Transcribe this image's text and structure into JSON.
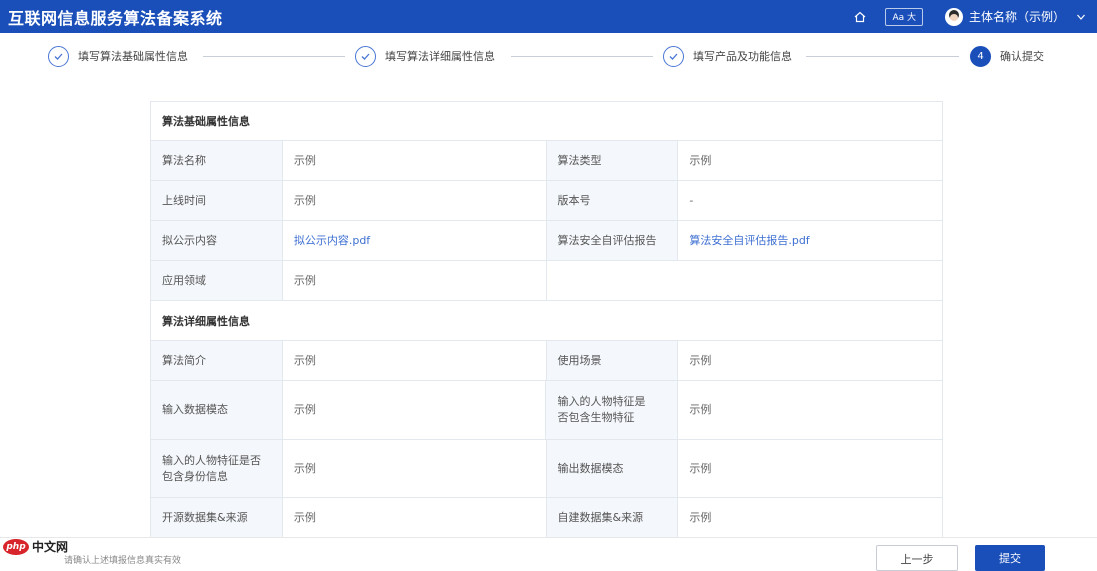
{
  "header": {
    "title": "互联网信息服务算法备案系统",
    "font_size_toggle": "Aa 大",
    "user_name": "主体名称（示例）",
    "icons": [
      "home-icon",
      "avatar",
      "chevron-down-icon"
    ]
  },
  "steps": [
    {
      "label": "填写算法基础属性信息",
      "status": "done"
    },
    {
      "label": "填写算法详细属性信息",
      "status": "done"
    },
    {
      "label": "填写产品及功能信息",
      "status": "done"
    },
    {
      "label": "确认提交",
      "number": "4",
      "status": "active"
    }
  ],
  "basic_section": {
    "title": "算法基础属性信息",
    "rows": [
      {
        "k1": "算法名称",
        "v1": "示例",
        "k2": "算法类型",
        "v2": "示例"
      },
      {
        "k1": "上线时间",
        "v1": "示例",
        "k2": "版本号",
        "v2": "-"
      },
      {
        "k1": "拟公示内容",
        "v1": "拟公示内容.pdf",
        "k2": "算法安全自评估报告",
        "v2": "算法安全自评估报告.pdf"
      },
      {
        "k1": "应用领域",
        "v1": "示例"
      }
    ]
  },
  "detail_section": {
    "title": "算法详细属性信息",
    "rows": [
      {
        "k1": "算法简介",
        "v1": "示例",
        "k2": "使用场景",
        "v2": "示例"
      },
      {
        "k1": "输入数据模态",
        "v1": "示例",
        "k2": "输入的人物特征是否包含生物特征",
        "v2": "示例"
      },
      {
        "k1": "输入的人物特征是否包含身份信息",
        "v1": "示例",
        "k2": "输出数据模态",
        "v2": "示例"
      },
      {
        "k1": "开源数据集&来源",
        "v1": "示例",
        "k2": "自建数据集&来源",
        "v2": "示例"
      }
    ]
  },
  "footer": {
    "notice": "请确认上述填报信息真实有效",
    "prev_label": "上一步",
    "submit_label": "提交"
  },
  "watermark": {
    "logo": "php",
    "text": "中文网"
  },
  "colors": {
    "primary": "#1a4fba",
    "link": "#3d6fd1",
    "key_bg": "#f4f7fb",
    "border": "#e3e7ee"
  }
}
